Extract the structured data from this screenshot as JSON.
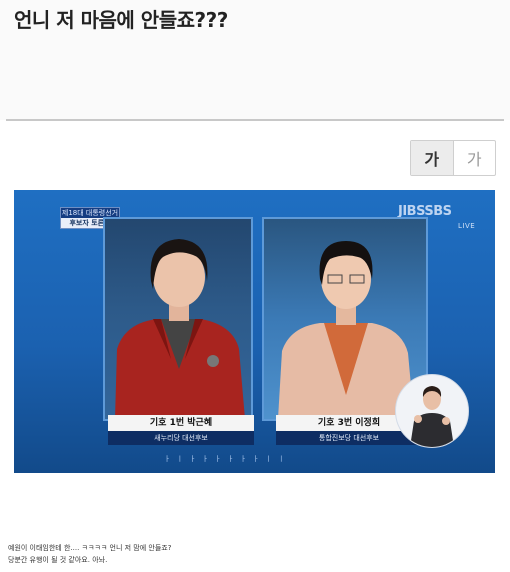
{
  "post": {
    "title": "언니 저 마음에 안들죠???"
  },
  "font_size_toggle": {
    "large_label": "가",
    "small_label": "가"
  },
  "broadcast": {
    "badge_line1": "제18대 대통령선거",
    "badge_line2": "후보자 토론회",
    "channel_logo": "JIBSSBS",
    "live_label": "LIVE",
    "candidate_left": {
      "number_name": "기호 1번  박근혜",
      "party": "새누리당 대선후보"
    },
    "candidate_right": {
      "number_name": "기호 3번  이정희",
      "party": "통합진보당 대선후보"
    },
    "ticker": "ㅏ ㅣ ㅏ ㅏ ㅏ ㅏ ㅏ ㅏ ㅣ ㅣ"
  },
  "captions": {
    "line1": "예원이 이태임한테 한.... ㅋㅋㅋㅋ 언니 저 맘에 안들죠?",
    "line2": "당분간 유행이 될 것 같아요. 아놔."
  },
  "colors": {
    "tv_blue": "#1f6fc2",
    "plate_navy": "#0e2d63",
    "jacket_red": "#a8241f",
    "jacket_pink": "#e6bba5"
  }
}
